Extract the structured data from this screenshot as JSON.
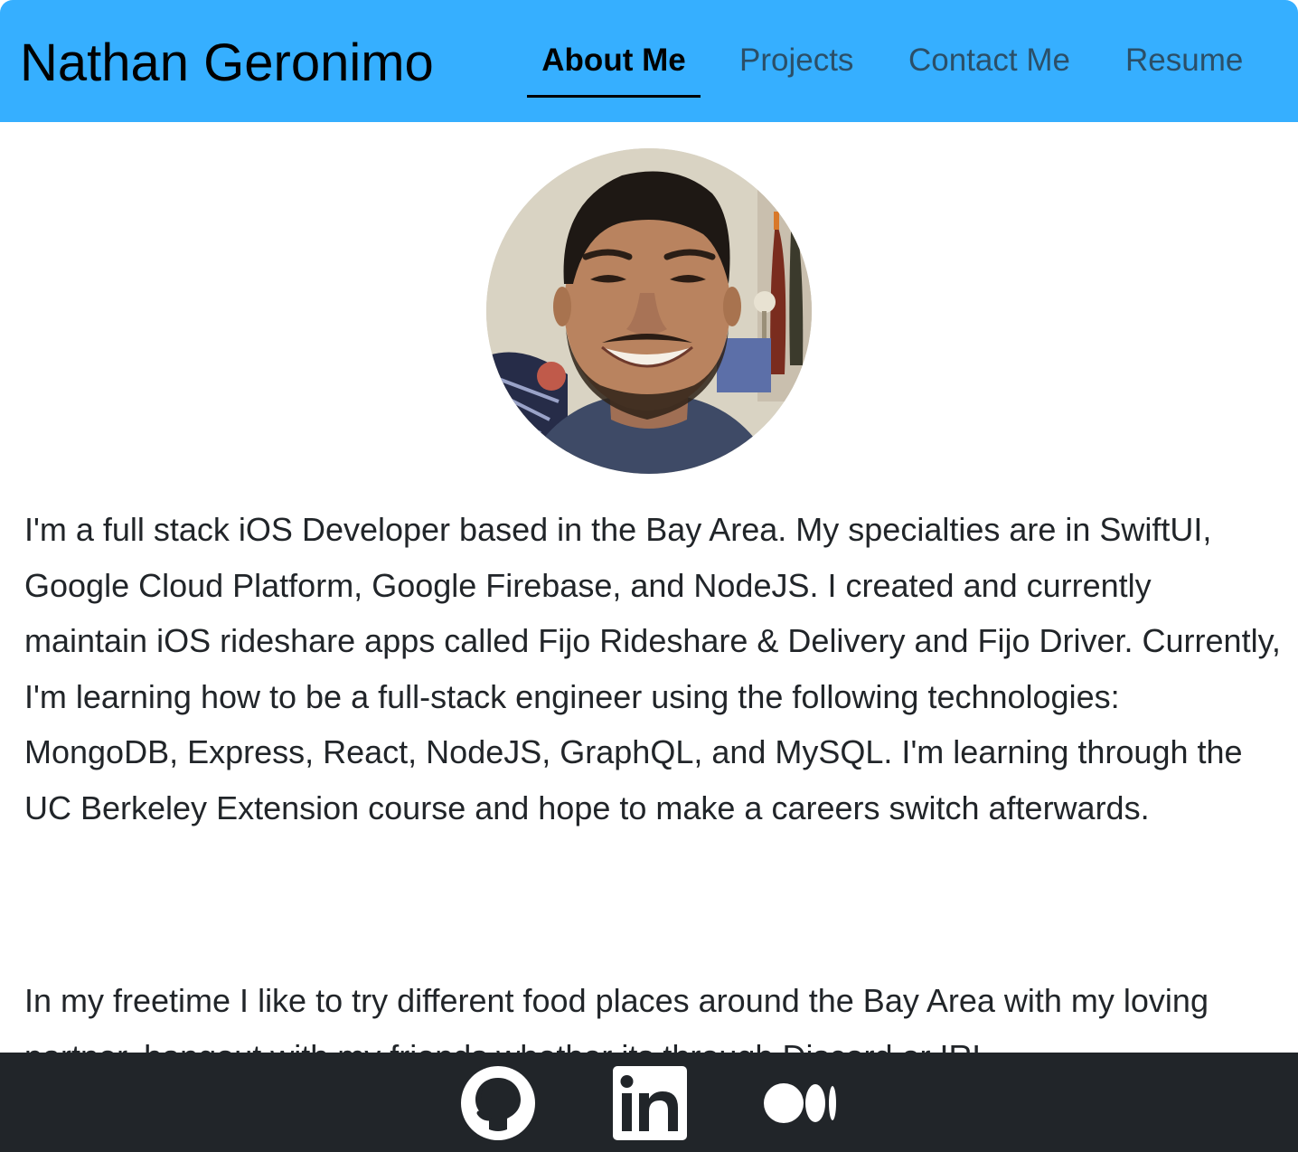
{
  "header": {
    "brand": "Nathan Geronimo",
    "nav": [
      {
        "label": "About Me",
        "active": true
      },
      {
        "label": "Projects",
        "active": false
      },
      {
        "label": "Contact Me",
        "active": false
      },
      {
        "label": "Resume",
        "active": false
      }
    ],
    "background_color": "#36afff"
  },
  "main": {
    "paragraphs": [
      "I'm a full stack iOS Developer based in the Bay Area. My specialties are in SwiftUI, Google Cloud Platform, Google Firebase, and NodeJS. I created and currently maintain iOS rideshare apps called Fijo Rideshare & Delivery and Fijo Driver. Currently, I'm learning how to be a full-stack engineer using the following technologies: MongoDB, Express, React, NodeJS, GraphQL, and MySQL. I'm learning through the UC Berkeley Extension course and hope to make a careers switch afterwards.",
      "In my freetime I like to try different food places around the Bay Area with my loving partner, hangout with my friends whether its through Discord or IRL"
    ]
  },
  "footer": {
    "background_color": "#212529",
    "icons": [
      "github-icon",
      "linkedin-icon",
      "medium-icon"
    ]
  }
}
